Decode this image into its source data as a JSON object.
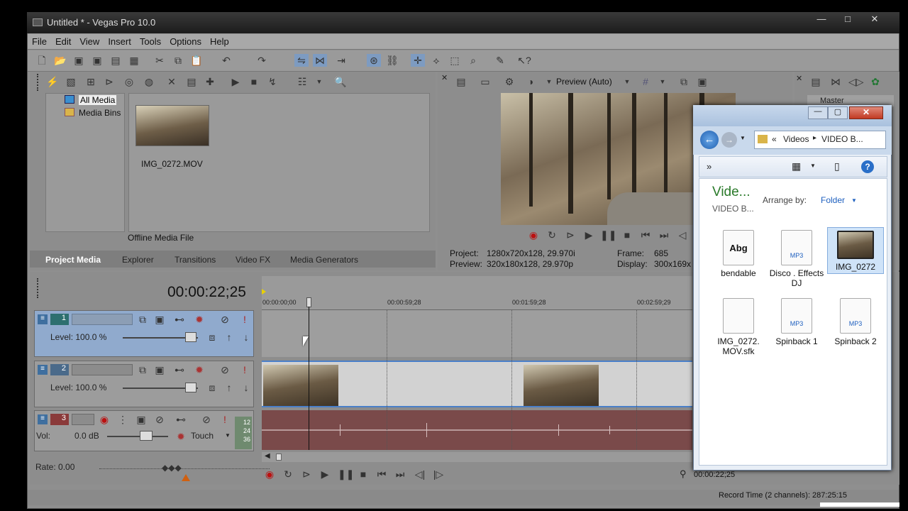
{
  "window": {
    "title": "Untitled * - Vegas Pro 10.0"
  },
  "menu": [
    "File",
    "Edit",
    "View",
    "Insert",
    "Tools",
    "Options",
    "Help"
  ],
  "project_media": {
    "tree": [
      "All Media",
      "Media Bins"
    ],
    "media_file": "IMG_0272.MOV",
    "status": "Offline Media File",
    "tabs": [
      "Project Media",
      "Explorer",
      "Transitions",
      "Video FX",
      "Media Generators"
    ]
  },
  "preview": {
    "mode": "Preview (Auto)",
    "project_label": "Project:",
    "project_value": "1280x720x128, 29.970i",
    "preview_label": "Preview:",
    "preview_value": "320x180x128, 29.970p",
    "frame_label": "Frame:",
    "frame_value": "685",
    "display_label": "Display:",
    "display_value": "300x169x"
  },
  "mixer": {
    "master_label": "Master"
  },
  "timeline": {
    "timecode": "00:00:22;25",
    "ruler": [
      "00:00:00;00",
      "00:00:59;28",
      "00:01:59;28",
      "00:02:59;29"
    ],
    "tracks": [
      {
        "num": "1",
        "level": "Level: 100.0 %"
      },
      {
        "num": "2",
        "level": "Level: 100.0 %"
      },
      {
        "num": "3",
        "vol_label": "Vol:",
        "vol": "0.0 dB",
        "mode": "Touch",
        "meter": [
          "12",
          "24",
          "36"
        ]
      }
    ],
    "rate": "Rate: 0.00",
    "end_time": "00:00:22;25"
  },
  "status": {
    "record_time": "Record Time (2 channels): 287:25:15"
  },
  "explorer": {
    "breadcrumb": [
      "«",
      "Videos",
      "VIDEO B..."
    ],
    "chevron": "»",
    "folder_title": "Vide...",
    "folder_sub": "VIDEO B...",
    "arrange_label": "Arrange by:",
    "arrange_value": "Folder",
    "files": [
      {
        "name": "bendable",
        "type": "abg",
        "icon_text": "Abg"
      },
      {
        "name": "Disco . Effects DJ",
        "type": "mp3",
        "icon_text": "MP3"
      },
      {
        "name": "IMG_0272",
        "type": "video",
        "icon_text": ""
      },
      {
        "name": "IMG_0272. MOV.sfk",
        "type": "doc",
        "icon_text": ""
      },
      {
        "name": "Spinback 1",
        "type": "mp3",
        "icon_text": "MP3"
      },
      {
        "name": "Spinback 2",
        "type": "mp3",
        "icon_text": "MP3"
      }
    ]
  }
}
